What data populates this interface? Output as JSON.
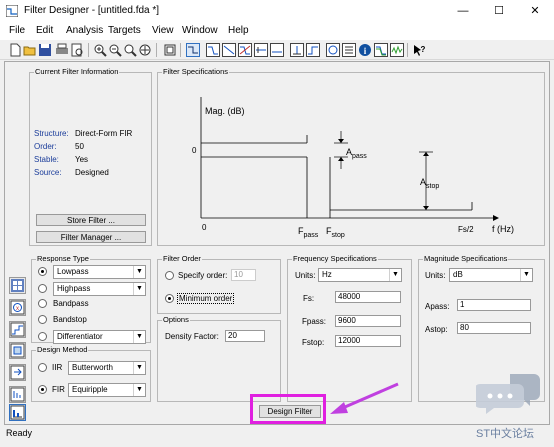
{
  "window": {
    "title": "Filter Designer - [untitled.fda *]",
    "minimize": "—",
    "maximize": "☐",
    "close": "✕"
  },
  "menu": [
    "File",
    "Edit",
    "Analysis",
    "Targets",
    "View",
    "Window",
    "Help"
  ],
  "toolbar": {
    "icons": [
      "new-icon",
      "open-icon",
      "save-icon",
      "print-icon",
      "print-preview-icon",
      "zoom-in-icon",
      "zoom-out-icon",
      "zoom-fit-icon",
      "full-view-icon",
      "filter-specs-icon",
      "magnitude-response-icon",
      "phase-response-icon",
      "mag-phase-icon",
      "group-delay-icon",
      "phase-delay-icon",
      "impulse-response-icon",
      "step-response-icon",
      "pole-zero-icon",
      "filter-coefficients-icon",
      "filter-info-icon",
      "magnitude-estimate-icon",
      "round-off-noise-icon",
      "whats-this-icon"
    ]
  },
  "current_filter": {
    "title": "Current Filter Information",
    "rows": [
      {
        "label": "Structure:",
        "value": "Direct-Form FIR"
      },
      {
        "label": "Order:",
        "value": "50"
      },
      {
        "label": "Stable:",
        "value": "Yes"
      },
      {
        "label": "Source:",
        "value": "Designed"
      }
    ],
    "store_button": "Store Filter ...",
    "manager_button": "Filter Manager ..."
  },
  "filter_specs": {
    "title": "Filter Specifications",
    "ylabel": "Mag. (dB)",
    "y_zero": "0",
    "x_zero": "0",
    "fpass": "F",
    "fpass_sub": "pass",
    "fstop": "F",
    "fstop_sub": "stop",
    "fs2": "Fs/2",
    "xlabel": "f (Hz)",
    "apass": "A",
    "apass_sub": "pass",
    "astop": "A",
    "astop_sub": "stop"
  },
  "response_type": {
    "title": "Response Type",
    "lowpass_value": "Lowpass",
    "highpass_value": "Highpass",
    "bandpass": "Bandpass",
    "bandstop": "Bandstop",
    "differentiator_value": "Differentiator",
    "selected": "lowpass"
  },
  "design_method": {
    "title": "Design Method",
    "iir": "IIR",
    "iir_value": "Butterworth",
    "fir": "FIR",
    "fir_value": "Equiripple",
    "selected": "fir"
  },
  "filter_order": {
    "title": "Filter Order",
    "specify": "Specify order:",
    "specify_value": "10",
    "minimum": "Minimum order",
    "selected": "minimum"
  },
  "options": {
    "title": "Options",
    "density_label": "Density Factor:",
    "density_value": "20"
  },
  "freq_specs": {
    "title": "Frequency Specifications",
    "units_label": "Units:",
    "units_value": "Hz",
    "fs_label": "Fs:",
    "fs_value": "48000",
    "fpass_label": "Fpass:",
    "fpass_value": "9600",
    "fstop_label": "Fstop:",
    "fstop_value": "12000"
  },
  "mag_specs": {
    "title": "Magnitude Specifications",
    "units_label": "Units:",
    "units_value": "dB",
    "apass_label": "Apass:",
    "apass_value": "1",
    "astop_label": "Astop:",
    "astop_value": "80"
  },
  "design_button": "Design Filter",
  "status": "Ready",
  "watermark": "ST中文论坛",
  "colors": {
    "highlight": "#e020e0",
    "arrow": "#c040e0"
  }
}
